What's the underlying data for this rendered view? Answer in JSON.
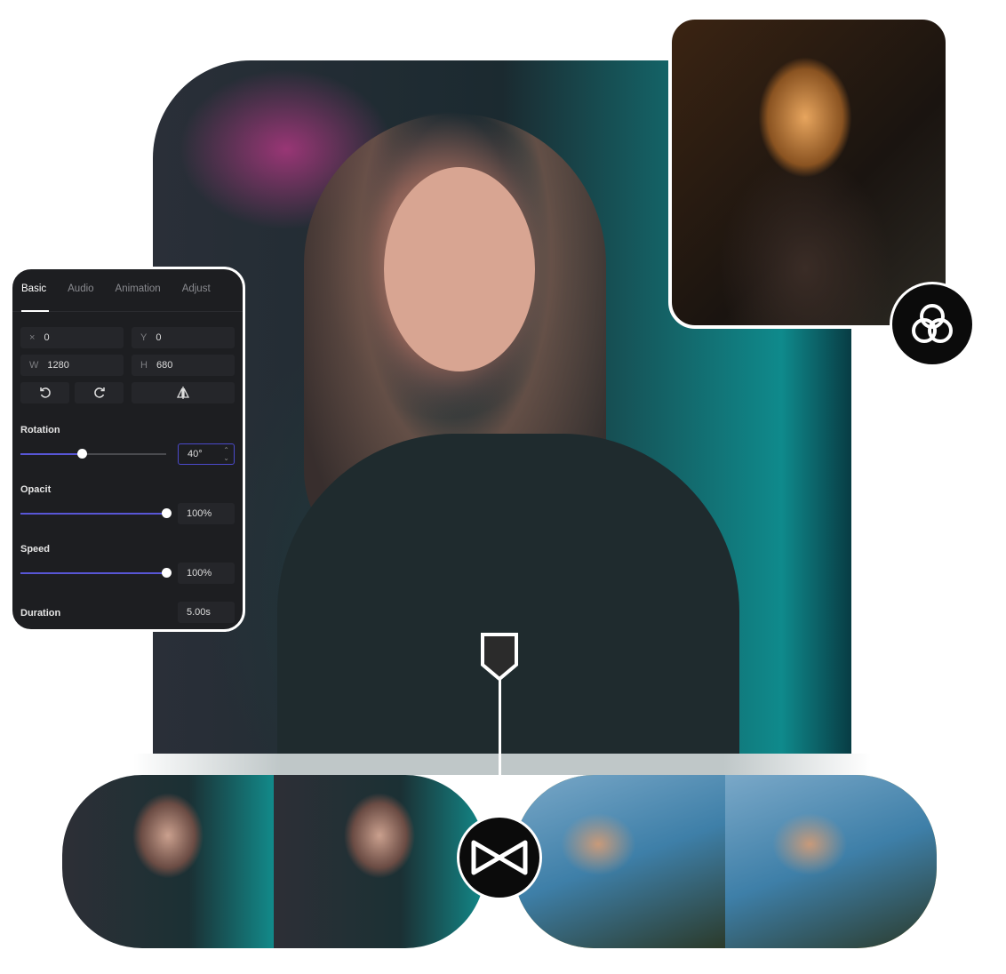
{
  "panel": {
    "tabs": [
      {
        "label": "Basic",
        "active": true
      },
      {
        "label": "Audio"
      },
      {
        "label": "Animation"
      },
      {
        "label": "Adjust"
      }
    ],
    "position": {
      "x_label": "×",
      "x": "0",
      "y_label": "Y",
      "y": "0",
      "w_label": "W",
      "w": "1280",
      "h_label": "H",
      "h": "680"
    },
    "actions": [
      "rotate-ccw-icon",
      "rotate-cw-icon",
      "flip-horizontal-icon"
    ],
    "rotation": {
      "label": "Rotation",
      "value": "40°",
      "fraction": 0.42
    },
    "opacity": {
      "label": "Opacit",
      "value": "100%",
      "fraction": 1.0
    },
    "speed": {
      "label": "Speed",
      "value": "100%",
      "fraction": 1.0
    },
    "duration": {
      "label": "Duration",
      "value": "5.00s"
    }
  },
  "colors": {
    "accent": "#5856d6",
    "panel_bg": "#1d1e21",
    "button_bg": "#0b0b0b"
  },
  "icons": {
    "filter": "filter-circles-icon",
    "transition": "bowtie-transition-icon",
    "marker": "playhead-marker-icon"
  }
}
